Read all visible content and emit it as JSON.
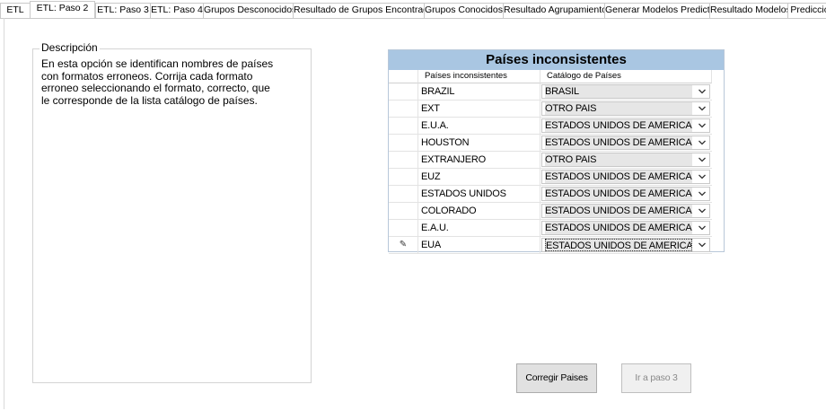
{
  "tabs": [
    {
      "label": "ETL",
      "active": false
    },
    {
      "label": "ETL: Paso 2",
      "active": true
    },
    {
      "label": "ETL: Paso 3",
      "active": false
    },
    {
      "label": "ETL: Paso 4",
      "active": false
    },
    {
      "label": "Grupos Desconocidos",
      "active": false
    },
    {
      "label": "Resultado de Grupos Encontrados",
      "active": false
    },
    {
      "label": "Grupos Conocidos",
      "active": false
    },
    {
      "label": "Resultado Agrupamiento",
      "active": false
    },
    {
      "label": "Generar Modelos Predictores",
      "active": false
    },
    {
      "label": "Resultado Modelos",
      "active": false
    },
    {
      "label": "Prediccio",
      "active": false
    }
  ],
  "description": {
    "title": "Descripción",
    "text_lines": [
      "En esta opción se identifican nombres de países",
      "con formatos erroneos. Corrija cada formato",
      "erroneo seleccionando el formato, correcto, que",
      "le corresponde de la lista catálogo de países."
    ]
  },
  "grid": {
    "title": "Países inconsistentes",
    "columns": [
      "Países inconsistentes",
      "Catálogo de Países"
    ],
    "rows": [
      {
        "country": "BRAZIL",
        "catalog": "BRASIL"
      },
      {
        "country": "EXT",
        "catalog": "OTRO PAIS"
      },
      {
        "country": "E.U.A.",
        "catalog": "ESTADOS UNIDOS DE AMERICA"
      },
      {
        "country": "HOUSTON",
        "catalog": "ESTADOS UNIDOS DE AMERICA"
      },
      {
        "country": "EXTRANJERO",
        "catalog": "OTRO PAIS"
      },
      {
        "country": "EUZ",
        "catalog": "ESTADOS UNIDOS DE AMERICA"
      },
      {
        "country": "ESTADOS UNIDOS",
        "catalog": "ESTADOS UNIDOS DE AMERICA"
      },
      {
        "country": "COLORADO",
        "catalog": "ESTADOS UNIDOS DE AMERICA"
      },
      {
        "country": "E.A.U.",
        "catalog": "ESTADOS UNIDOS DE AMERICA"
      },
      {
        "country": "EUA",
        "catalog": "ESTADOS UNIDOS DE AMERICA",
        "editing": true
      }
    ],
    "edit_row_marker": "✎",
    "dropdown_icon": "chevron-down-icon"
  },
  "buttons": {
    "fix": "Corregir Paises",
    "next": "Ir a paso 3"
  }
}
